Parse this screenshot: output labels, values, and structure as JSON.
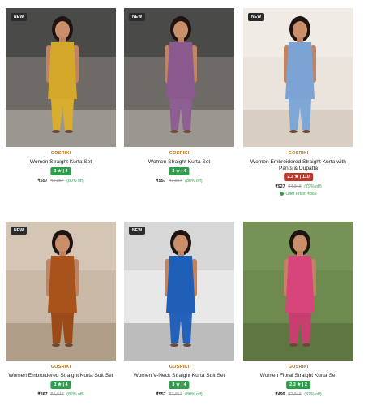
{
  "products": [
    {
      "badge": "NEW",
      "brand": "GOSRIKI",
      "title": "Women Straight Kurta Set",
      "rating": "3 ★ | 4",
      "rating_color": "#2e9e4a",
      "price": "₹557",
      "mrp": "₹2,857",
      "off": "(80% off)",
      "offer": "",
      "image_colors": {
        "bg": "#6e6a66",
        "top": "#3a3f3c",
        "floor": "#9a9690",
        "garment": "#d4a82a",
        "pants": "#d9ae2e"
      }
    },
    {
      "badge": "NEW",
      "brand": "GOSRIKI",
      "title": "Women Straight Kurta Set",
      "rating": "3 ★ | 4",
      "rating_color": "#2e9e4a",
      "price": "₹557",
      "mrp": "₹2,857",
      "off": "(80% off)",
      "offer": "",
      "image_colors": {
        "bg": "#6e6a66",
        "top": "#3a3f3c",
        "floor": "#9a9690",
        "garment": "#8a5a8e",
        "pants": "#8e5f92"
      }
    },
    {
      "badge": "NEW",
      "brand": "GOSRIKI",
      "title": "Women Embroidered Straight Kurta with Pants & Dupatta",
      "rating": "2.3 ★ | 110",
      "rating_color": "#c0392b",
      "price": "₹927",
      "mrp": "₹4,848",
      "off": "(79% off)",
      "offer": "Offer Price: ₹889",
      "image_colors": {
        "bg": "#eae4dc",
        "top": "#f2eee8",
        "floor": "#d8cfc2",
        "garment": "#7ba3d4",
        "pants": "#7ea6d6"
      }
    },
    {
      "badge": "NEW",
      "brand": "GOSRIKI",
      "title": "Women Embroidered Straight Kurta Suit Set",
      "rating": "3 ★ | 4",
      "rating_color": "#2e9e4a",
      "price": "₹867",
      "mrp": "₹4,848",
      "off": "(82% off)",
      "offer": "",
      "image_colors": {
        "bg": "#c9b9a6",
        "top": "#d8cabb",
        "floor": "#b09d88",
        "garment": "#a8521c",
        "pants": "#9c4a18"
      }
    },
    {
      "badge": "NEW",
      "brand": "GOSRIKI",
      "title": "Women V-Neck Straight Kurta Suit Set",
      "rating": "3 ★ | 4",
      "rating_color": "#2e9e4a",
      "price": "₹557",
      "mrp": "₹2,857",
      "off": "(80% off)",
      "offer": "",
      "image_colors": {
        "bg": "#e8e8e8",
        "top": "#d0d0d0",
        "floor": "#bcbcbc",
        "garment": "#1f5fb8",
        "pants": "#2462ba"
      }
    },
    {
      "badge": "",
      "brand": "GOSRIKI",
      "title": "Women Floral Straight Kurta Set",
      "rating": "2.3 ★ | 2",
      "rating_color": "#2e9e4a",
      "price": "₹499",
      "mrp": "₹2,848",
      "off": "(82% off)",
      "offer": "",
      "image_colors": {
        "bg": "#6f8a4e",
        "top": "#7b965a",
        "floor": "#5e7742",
        "garment": "#d8457a",
        "pants": "#c93e70"
      }
    }
  ]
}
